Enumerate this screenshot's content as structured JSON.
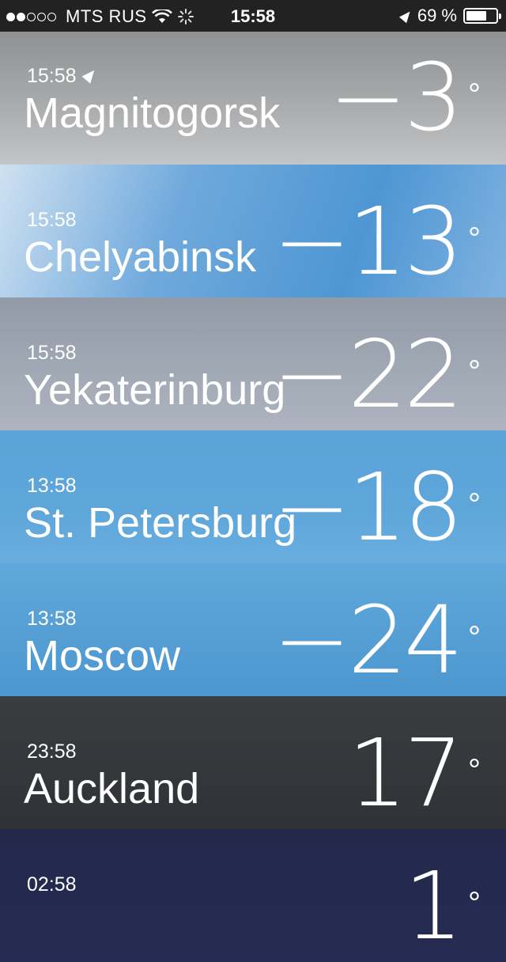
{
  "status_bar": {
    "carrier": "MTS RUS",
    "time": "15:58",
    "battery_percent_text": "69 %",
    "battery_level": 0.69
  },
  "cities": [
    {
      "time": "15:58",
      "name": "Magnitogorsk",
      "temp": "−3",
      "degree": "°",
      "current_location": true,
      "bg": "cloudy-gray"
    },
    {
      "time": "15:58",
      "name": "Chelyabinsk",
      "temp": "−13",
      "degree": "°",
      "current_location": false,
      "bg": "blue-sky-clouds"
    },
    {
      "time": "15:58",
      "name": "Yekaterinburg",
      "temp": "−22",
      "degree": "°",
      "current_location": false,
      "bg": "overcast-gray"
    },
    {
      "time": "13:58",
      "name": "St. Petersburg",
      "temp": "−18",
      "degree": "°",
      "current_location": false,
      "bg": "blue-sky"
    },
    {
      "time": "13:58",
      "name": "Moscow",
      "temp": "−24",
      "degree": "°",
      "current_location": false,
      "bg": "blue-sky"
    },
    {
      "time": "23:58",
      "name": "Auckland",
      "temp": "17",
      "degree": "°",
      "current_location": false,
      "bg": "dark-cloudy"
    },
    {
      "time": "02:58",
      "name": "",
      "temp": "1",
      "degree": "°",
      "current_location": false,
      "bg": "night-stars"
    }
  ]
}
